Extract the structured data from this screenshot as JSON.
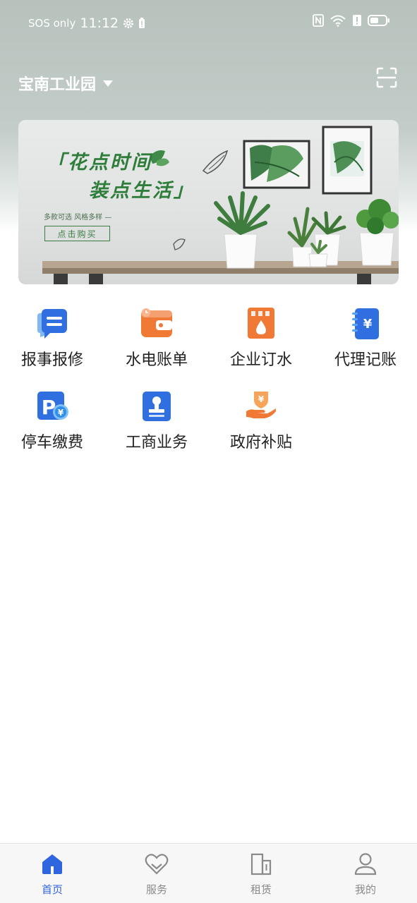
{
  "status_bar": {
    "carrier": "SOS only",
    "time": "11:12",
    "battery_level": 0.55
  },
  "header": {
    "park_name": "宝南工业园"
  },
  "banner": {
    "title_line1": "「花点时间",
    "title_line2": "装点生活」",
    "subtitle": "多款可选 风格多样 —",
    "button_label": "点击购买"
  },
  "services": [
    {
      "label": "报事报修",
      "icon": "message-icon"
    },
    {
      "label": "水电账单",
      "icon": "wallet-icon"
    },
    {
      "label": "企业订水",
      "icon": "water-order-icon"
    },
    {
      "label": "代理记账",
      "icon": "accounting-book-icon"
    },
    {
      "label": "停车缴费",
      "icon": "parking-icon"
    },
    {
      "label": "工商业务",
      "icon": "stamp-icon"
    },
    {
      "label": "政府补贴",
      "icon": "subsidy-hand-icon"
    }
  ],
  "bottom_nav": {
    "items": [
      {
        "label": "首页",
        "icon": "home-icon",
        "active": true
      },
      {
        "label": "服务",
        "icon": "heart-icon",
        "active": false
      },
      {
        "label": "租赁",
        "icon": "building-icon",
        "active": false
      },
      {
        "label": "我的",
        "icon": "user-icon",
        "active": false
      }
    ]
  },
  "colors": {
    "accent": "#2f66e0",
    "inactive": "#8a8a8a",
    "banner_green": "#2e7d3a",
    "orange": "#f07a35",
    "blue": "#2f6fe0"
  }
}
